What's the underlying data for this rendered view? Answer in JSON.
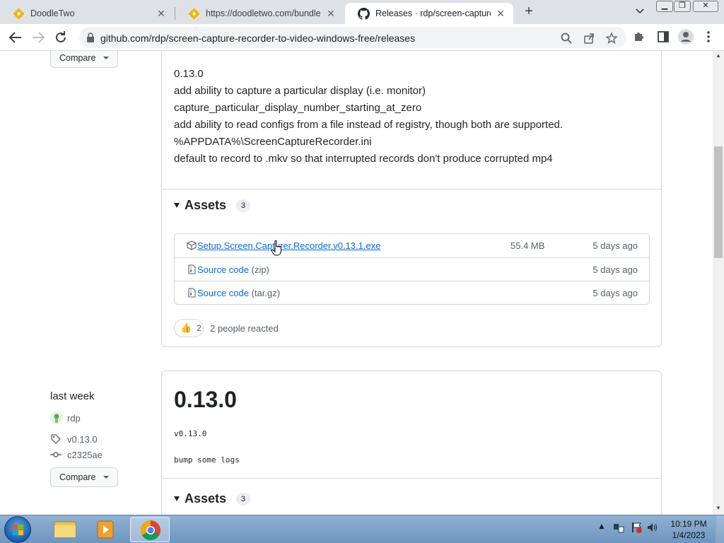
{
  "browser": {
    "tabs": [
      {
        "title": "DoodleTwo",
        "icon": "doodletwo-icon",
        "active": false
      },
      {
        "title": "https://doodletwo.com/bundle.js",
        "icon": "doodletwo-icon",
        "active": false
      },
      {
        "title": "Releases · rdp/screen-capture-re",
        "icon": "github-icon",
        "active": true
      }
    ],
    "url": "github.com/rdp/screen-capture-recorder-to-video-windows-free/releases"
  },
  "release_top": {
    "compare_label": "Compare",
    "notes": [
      "0.13.0",
      "add ability to capture a particular display (i.e. monitor)",
      "capture_particular_display_number_starting_at_zero",
      "add ability to read configs from a file instead of registry, though both are supported.",
      "%APPDATA%\\ScreenCaptureRecorder.ini",
      "default to record to .mkv so that interrupted records don't produce corrupted mp4"
    ],
    "assets_title": "Assets",
    "assets_count": "3",
    "assets": [
      {
        "name": "Setup.Screen.Capturer.Recorder.v0.13.1.exe",
        "suffix": "",
        "size": "55.4 MB",
        "date": "5 days ago",
        "icon": "package-icon"
      },
      {
        "name": "Source code",
        "suffix": " (zip)",
        "size": "",
        "date": "5 days ago",
        "icon": "file-zip-icon"
      },
      {
        "name": "Source code",
        "suffix": " (tar.gz)",
        "size": "",
        "date": "5 days ago",
        "icon": "file-zip-icon"
      }
    ],
    "reaction_emoji": "👍",
    "reaction_count": "2",
    "reacted_text": "2 people reacted"
  },
  "release_second": {
    "date": "last week",
    "author": "rdp",
    "tag": "v0.13.0",
    "commit": "c2325ae",
    "compare_label": "Compare",
    "title": "0.13.0",
    "tag_line": "v0.13.0",
    "body": "bump some logs",
    "assets_title": "Assets",
    "assets_count": "3"
  },
  "taskbar": {
    "time": "10:19 PM",
    "date": "1/4/2023"
  }
}
